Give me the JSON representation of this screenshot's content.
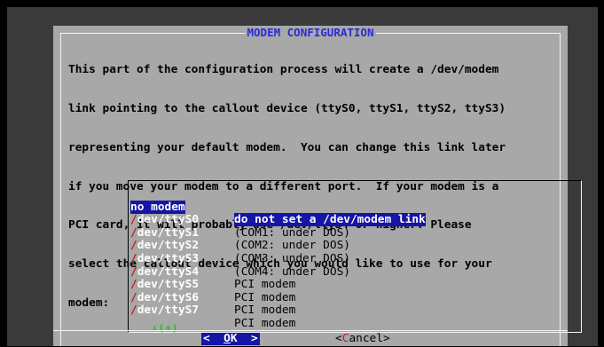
{
  "dialog": {
    "title": "MODEM CONFIGURATION",
    "description": [
      "This part of the configuration process will create a /dev/modem",
      "link pointing to the callout device (ttyS0, ttyS1, ttyS2, ttyS3)",
      "representing your default modem.  You can change this link later",
      "if you move your modem to a different port.  If your modem is a",
      "PCI card, it will probably use /dev/ttyS4 or higher. Please",
      "select the callout device which you would like to use for your",
      "modem:"
    ],
    "menu": [
      {
        "tag_first": "n",
        "tag_rest": "o modem",
        "item": "do not set a /dev/modem link",
        "selected": true
      },
      {
        "tag_first": "/",
        "tag_rest": "dev/ttyS0",
        "item": "(COM1: under DOS)"
      },
      {
        "tag_first": "/",
        "tag_rest": "dev/ttyS1",
        "item": "(COM2: under DOS)"
      },
      {
        "tag_first": "/",
        "tag_rest": "dev/ttyS2",
        "item": "(COM3: under DOS)"
      },
      {
        "tag_first": "/",
        "tag_rest": "dev/ttyS3",
        "item": "(COM4: under DOS)"
      },
      {
        "tag_first": "/",
        "tag_rest": "dev/ttyS4",
        "item": "PCI modem"
      },
      {
        "tag_first": "/",
        "tag_rest": "dev/ttyS5",
        "item": "PCI modem"
      },
      {
        "tag_first": "/",
        "tag_rest": "dev/ttyS6",
        "item": "PCI modem"
      },
      {
        "tag_first": "/",
        "tag_rest": "dev/ttyS7",
        "item": "PCI modem"
      }
    ],
    "scroll_indicator": "↓(+)",
    "ok_button": {
      "left": "<  ",
      "hot": "O",
      "rest": "K",
      "right": "  >"
    },
    "cancel_button": {
      "left": "<",
      "hot": "C",
      "rest": "ancel>"
    }
  },
  "colors": {
    "background": "#3a3a3a",
    "dialog": "#a8a8a8",
    "title": "#2b2bd6",
    "highlight": "#1515a6",
    "hotkey": "#c21b1b",
    "scroll": "#1bbd1b"
  }
}
